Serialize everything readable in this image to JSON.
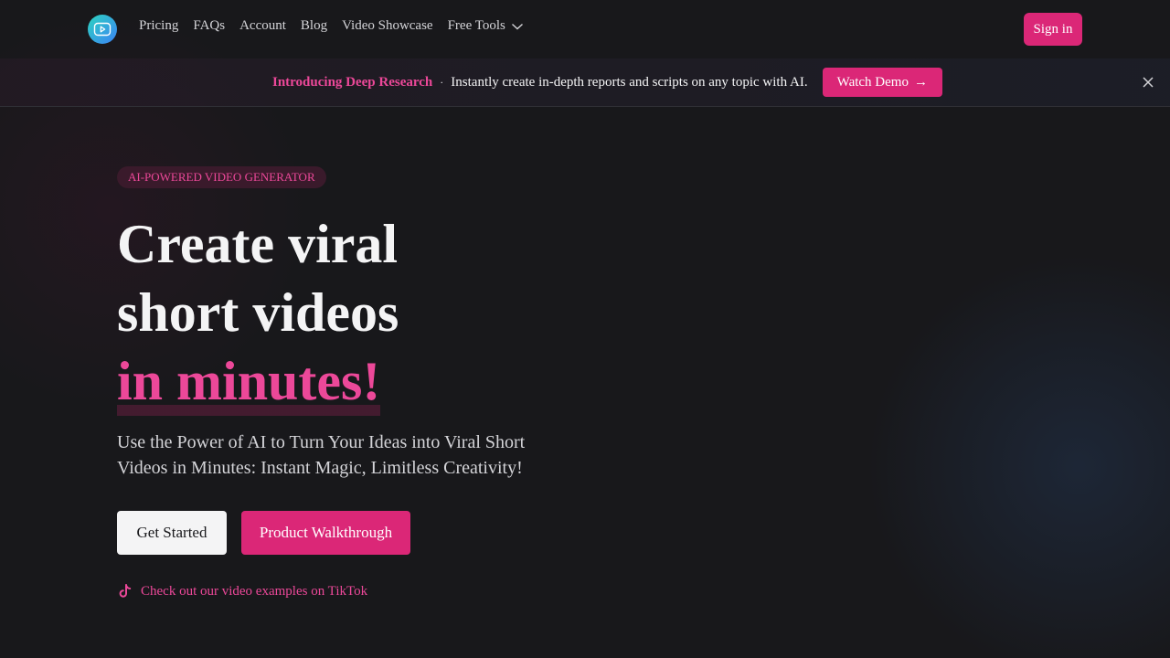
{
  "nav": {
    "logo_icon": "play-video-icon",
    "items": [
      "Pricing",
      "FAQs",
      "Account",
      "Blog",
      "Video Showcase"
    ],
    "free_tools_label": "Free Tools",
    "signin_label": "Sign in"
  },
  "banner": {
    "highlight": "Introducing Deep Research",
    "separator": "·",
    "text": "Instantly create in-depth reports and scripts on any topic with AI.",
    "cta_label": "Watch Demo",
    "cta_arrow": "→"
  },
  "hero": {
    "badge": "AI-POWERED VIDEO GENERATOR",
    "headline_line1": "Create viral",
    "headline_line2": "short videos",
    "headline_accent": "in minutes!",
    "subtitle": "Use the Power of AI to Turn Your Ideas into Viral Short Videos in Minutes: Instant Magic, Limitless Creativity!",
    "primary_cta": "Get Started",
    "secondary_cta": "Product Walkthrough",
    "tiktok_link": "Check out our video examples on TikTok"
  },
  "colors": {
    "accent": "#db2777",
    "accent_text": "#ec4899",
    "background": "#18181b"
  }
}
